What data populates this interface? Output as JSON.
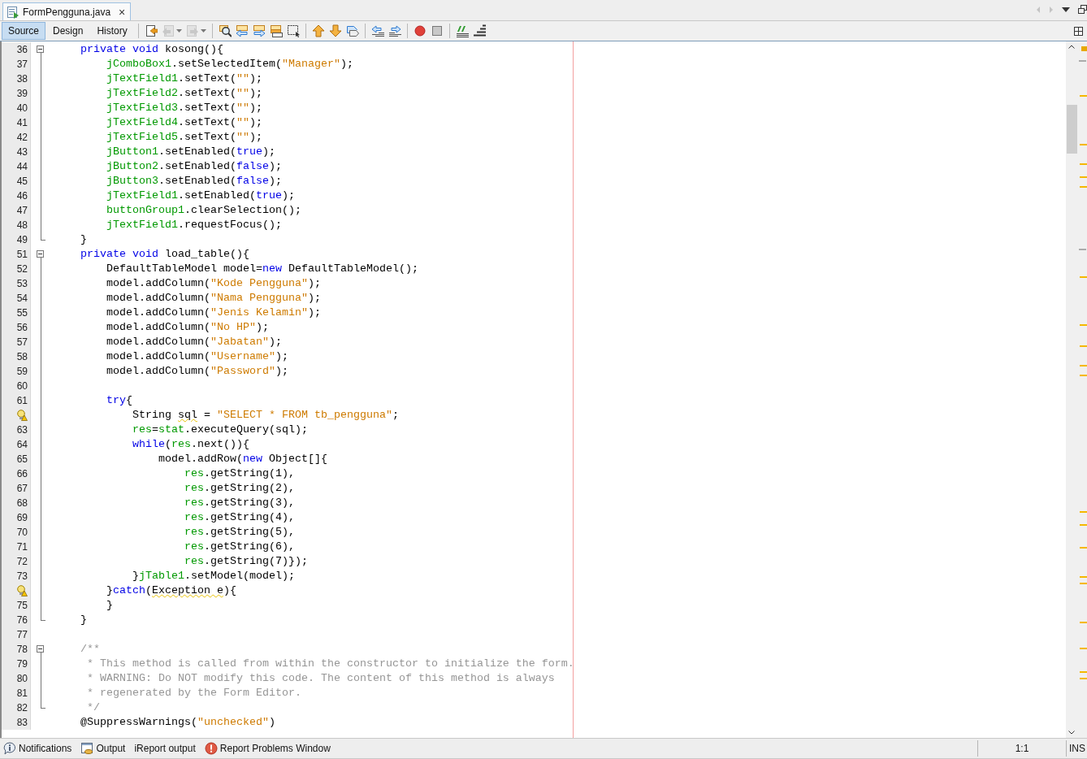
{
  "editor_tab": {
    "title": "FormPengguna.java",
    "close": "×"
  },
  "views": [
    {
      "label": "Source",
      "selected": true
    },
    {
      "label": "Design",
      "selected": false
    },
    {
      "label": "History",
      "selected": false
    }
  ],
  "toolbar": [
    {
      "kind": "last-edit",
      "disabled": false,
      "dropdown": false
    },
    {
      "kind": "back",
      "disabled": true,
      "dropdown": true
    },
    {
      "kind": "forward",
      "disabled": true,
      "dropdown": true
    },
    {
      "kind": "find",
      "disabled": false,
      "dropdown": false
    },
    {
      "kind": "find-previous",
      "disabled": false,
      "dropdown": false
    },
    {
      "kind": "find-next",
      "disabled": false,
      "dropdown": false
    },
    {
      "kind": "highlight",
      "disabled": false,
      "dropdown": false
    },
    {
      "kind": "select",
      "disabled": false,
      "dropdown": false
    },
    {
      "kind": "bookmark-previous",
      "disabled": false,
      "dropdown": false
    },
    {
      "kind": "bookmark-next",
      "disabled": false,
      "dropdown": false
    },
    {
      "kind": "bookmark-toggle",
      "disabled": false,
      "dropdown": false
    },
    {
      "kind": "shift-left",
      "disabled": false,
      "dropdown": false
    },
    {
      "kind": "shift-right",
      "disabled": false,
      "dropdown": false
    },
    {
      "kind": "record",
      "disabled": false,
      "dropdown": false
    },
    {
      "kind": "stop",
      "disabled": false,
      "dropdown": false
    },
    {
      "kind": "comment",
      "disabled": false,
      "dropdown": false
    },
    {
      "kind": "uncomment",
      "disabled": false,
      "dropdown": false
    }
  ],
  "lines": [
    {
      "number": "36",
      "warning": false,
      "kind": "start",
      "tokens": [
        {
          "kind": "keyword",
          "text": "    private"
        },
        {
          "kind": "keyword",
          "text": " void"
        },
        {
          "kind": "plain",
          "text": " kosong(){"
        }
      ]
    },
    {
      "number": "37",
      "warning": false,
      "kind": "inside",
      "tokens": [
        {
          "kind": "field",
          "text": "        jComboBox1"
        },
        {
          "kind": "plain",
          "text": ".setSelectedItem("
        },
        {
          "kind": "string",
          "text": "\"Manager\""
        },
        {
          "kind": "plain",
          "text": ");"
        }
      ]
    },
    {
      "number": "38",
      "warning": false,
      "kind": "inside",
      "tokens": [
        {
          "kind": "field",
          "text": "        jTextField1"
        },
        {
          "kind": "plain",
          "text": ".setText("
        },
        {
          "kind": "string",
          "text": "\"\""
        },
        {
          "kind": "plain",
          "text": ");"
        }
      ]
    },
    {
      "number": "39",
      "warning": false,
      "kind": "inside",
      "tokens": [
        {
          "kind": "field",
          "text": "        jTextField2"
        },
        {
          "kind": "plain",
          "text": ".setText("
        },
        {
          "kind": "string",
          "text": "\"\""
        },
        {
          "kind": "plain",
          "text": ");"
        }
      ]
    },
    {
      "number": "40",
      "warning": false,
      "kind": "inside",
      "tokens": [
        {
          "kind": "field",
          "text": "        jTextField3"
        },
        {
          "kind": "plain",
          "text": ".setText("
        },
        {
          "kind": "string",
          "text": "\"\""
        },
        {
          "kind": "plain",
          "text": ");"
        }
      ]
    },
    {
      "number": "41",
      "warning": false,
      "kind": "inside",
      "tokens": [
        {
          "kind": "field",
          "text": "        jTextField4"
        },
        {
          "kind": "plain",
          "text": ".setText("
        },
        {
          "kind": "string",
          "text": "\"\""
        },
        {
          "kind": "plain",
          "text": ");"
        }
      ]
    },
    {
      "number": "42",
      "warning": false,
      "kind": "inside",
      "tokens": [
        {
          "kind": "field",
          "text": "        jTextField5"
        },
        {
          "kind": "plain",
          "text": ".setText("
        },
        {
          "kind": "string",
          "text": "\"\""
        },
        {
          "kind": "plain",
          "text": ");"
        }
      ]
    },
    {
      "number": "43",
      "warning": false,
      "kind": "inside",
      "tokens": [
        {
          "kind": "field",
          "text": "        jButton1"
        },
        {
          "kind": "plain",
          "text": ".setEnabled("
        },
        {
          "kind": "keyword",
          "text": "true"
        },
        {
          "kind": "plain",
          "text": ");"
        }
      ]
    },
    {
      "number": "44",
      "warning": false,
      "kind": "inside",
      "tokens": [
        {
          "kind": "field",
          "text": "        jButton2"
        },
        {
          "kind": "plain",
          "text": ".setEnabled("
        },
        {
          "kind": "keyword",
          "text": "false"
        },
        {
          "kind": "plain",
          "text": ");"
        }
      ]
    },
    {
      "number": "45",
      "warning": false,
      "kind": "inside",
      "tokens": [
        {
          "kind": "field",
          "text": "        jButton3"
        },
        {
          "kind": "plain",
          "text": ".setEnabled("
        },
        {
          "kind": "keyword",
          "text": "false"
        },
        {
          "kind": "plain",
          "text": ");"
        }
      ]
    },
    {
      "number": "46",
      "warning": false,
      "kind": "inside",
      "tokens": [
        {
          "kind": "field",
          "text": "        jTextField1"
        },
        {
          "kind": "plain",
          "text": ".setEnabled("
        },
        {
          "kind": "keyword",
          "text": "true"
        },
        {
          "kind": "plain",
          "text": ");"
        }
      ]
    },
    {
      "number": "47",
      "warning": false,
      "kind": "inside",
      "tokens": [
        {
          "kind": "field",
          "text": "        buttonGroup1"
        },
        {
          "kind": "plain",
          "text": ".clearSelection();"
        }
      ]
    },
    {
      "number": "48",
      "warning": false,
      "kind": "inside",
      "tokens": [
        {
          "kind": "field",
          "text": "        jTextField1"
        },
        {
          "kind": "plain",
          "text": ".requestFocus();"
        }
      ]
    },
    {
      "number": "49",
      "warning": false,
      "kind": "end",
      "tokens": [
        {
          "kind": "plain",
          "text": "    }"
        }
      ]
    },
    {
      "number": "51",
      "warning": false,
      "kind": "start",
      "tokens": [
        {
          "kind": "keyword",
          "text": "    private"
        },
        {
          "kind": "keyword",
          "text": " void"
        },
        {
          "kind": "plain",
          "text": " load_table(){"
        }
      ]
    },
    {
      "number": "52",
      "warning": false,
      "kind": "inside",
      "tokens": [
        {
          "kind": "plain",
          "text": "        DefaultTableModel model="
        },
        {
          "kind": "keyword",
          "text": "new"
        },
        {
          "kind": "plain",
          "text": " DefaultTableModel();"
        }
      ]
    },
    {
      "number": "53",
      "warning": false,
      "kind": "inside",
      "tokens": [
        {
          "kind": "plain",
          "text": "        model.addColumn("
        },
        {
          "kind": "string",
          "text": "\"Kode Pengguna\""
        },
        {
          "kind": "plain",
          "text": ");"
        }
      ]
    },
    {
      "number": "54",
      "warning": false,
      "kind": "inside",
      "tokens": [
        {
          "kind": "plain",
          "text": "        model.addColumn("
        },
        {
          "kind": "string",
          "text": "\"Nama Pengguna\""
        },
        {
          "kind": "plain",
          "text": ");"
        }
      ]
    },
    {
      "number": "55",
      "warning": false,
      "kind": "inside",
      "tokens": [
        {
          "kind": "plain",
          "text": "        model.addColumn("
        },
        {
          "kind": "string",
          "text": "\"Jenis Kelamin\""
        },
        {
          "kind": "plain",
          "text": ");"
        }
      ]
    },
    {
      "number": "56",
      "warning": false,
      "kind": "inside",
      "tokens": [
        {
          "kind": "plain",
          "text": "        model.addColumn("
        },
        {
          "kind": "string",
          "text": "\"No HP\""
        },
        {
          "kind": "plain",
          "text": ");"
        }
      ]
    },
    {
      "number": "57",
      "warning": false,
      "kind": "inside",
      "tokens": [
        {
          "kind": "plain",
          "text": "        model.addColumn("
        },
        {
          "kind": "string",
          "text": "\"Jabatan\""
        },
        {
          "kind": "plain",
          "text": ");"
        }
      ]
    },
    {
      "number": "58",
      "warning": false,
      "kind": "inside",
      "tokens": [
        {
          "kind": "plain",
          "text": "        model.addColumn("
        },
        {
          "kind": "string",
          "text": "\"Username\""
        },
        {
          "kind": "plain",
          "text": ");"
        }
      ]
    },
    {
      "number": "59",
      "warning": false,
      "kind": "inside",
      "tokens": [
        {
          "kind": "plain",
          "text": "        model.addColumn("
        },
        {
          "kind": "string",
          "text": "\"Password\""
        },
        {
          "kind": "plain",
          "text": ");"
        }
      ]
    },
    {
      "number": "60",
      "warning": false,
      "kind": "inside"
    },
    {
      "number": "61",
      "warning": false,
      "kind": "inside",
      "tokens": [
        {
          "kind": "keyword",
          "text": "        try"
        },
        {
          "kind": "plain",
          "text": "{"
        }
      ]
    },
    {
      "warning": true,
      "kind": "inside",
      "tokens": [
        {
          "kind": "plain",
          "text": "            String "
        },
        {
          "kind": "warned",
          "text": "sql"
        },
        {
          "kind": "plain",
          "text": " = "
        },
        {
          "kind": "string",
          "text": "\"SELECT * FROM tb_pengguna\""
        },
        {
          "kind": "plain",
          "text": ";"
        }
      ]
    },
    {
      "number": "63",
      "warning": false,
      "kind": "inside",
      "tokens": [
        {
          "kind": "field",
          "text": "            res"
        },
        {
          "kind": "plain",
          "text": "="
        },
        {
          "kind": "field",
          "text": "stat"
        },
        {
          "kind": "plain",
          "text": ".executeQuery(sql);"
        }
      ]
    },
    {
      "number": "64",
      "warning": false,
      "kind": "inside",
      "tokens": [
        {
          "kind": "keyword",
          "text": "            while"
        },
        {
          "kind": "plain",
          "text": "("
        },
        {
          "kind": "field",
          "text": "res"
        },
        {
          "kind": "plain",
          "text": ".next()){"
        }
      ]
    },
    {
      "number": "65",
      "warning": false,
      "kind": "inside",
      "tokens": [
        {
          "kind": "plain",
          "text": "                model.addRow("
        },
        {
          "kind": "keyword",
          "text": "new"
        },
        {
          "kind": "plain",
          "text": " Object[]{"
        }
      ]
    },
    {
      "number": "66",
      "warning": false,
      "kind": "inside",
      "tokens": [
        {
          "kind": "field",
          "text": "                    res"
        },
        {
          "kind": "plain",
          "text": ".getString(1),"
        }
      ]
    },
    {
      "number": "67",
      "warning": false,
      "kind": "inside",
      "tokens": [
        {
          "kind": "field",
          "text": "                    res"
        },
        {
          "kind": "plain",
          "text": ".getString(2),"
        }
      ]
    },
    {
      "number": "68",
      "warning": false,
      "kind": "inside",
      "tokens": [
        {
          "kind": "field",
          "text": "                    res"
        },
        {
          "kind": "plain",
          "text": ".getString(3),"
        }
      ]
    },
    {
      "number": "69",
      "warning": false,
      "kind": "inside",
      "tokens": [
        {
          "kind": "field",
          "text": "                    res"
        },
        {
          "kind": "plain",
          "text": ".getString(4),"
        }
      ]
    },
    {
      "number": "70",
      "warning": false,
      "kind": "inside",
      "tokens": [
        {
          "kind": "field",
          "text": "                    res"
        },
        {
          "kind": "plain",
          "text": ".getString(5),"
        }
      ]
    },
    {
      "number": "71",
      "warning": false,
      "kind": "inside",
      "tokens": [
        {
          "kind": "field",
          "text": "                    res"
        },
        {
          "kind": "plain",
          "text": ".getString(6),"
        }
      ]
    },
    {
      "number": "72",
      "warning": false,
      "kind": "inside",
      "tokens": [
        {
          "kind": "field",
          "text": "                    res"
        },
        {
          "kind": "plain",
          "text": ".getString(7)});"
        }
      ]
    },
    {
      "number": "73",
      "warning": false,
      "kind": "inside",
      "tokens": [
        {
          "kind": "plain",
          "text": "            }"
        },
        {
          "kind": "field",
          "text": "jTable1"
        },
        {
          "kind": "plain",
          "text": ".setModel(model);"
        }
      ]
    },
    {
      "warning": true,
      "kind": "inside",
      "tokens": [
        {
          "kind": "plain",
          "text": "        }"
        },
        {
          "kind": "keyword",
          "text": "catch"
        },
        {
          "kind": "plain",
          "text": "("
        },
        {
          "kind": "warned",
          "text": "Exception e"
        },
        {
          "kind": "plain",
          "text": "){"
        }
      ]
    },
    {
      "number": "75",
      "warning": false,
      "kind": "inside",
      "tokens": [
        {
          "kind": "plain",
          "text": "        }"
        }
      ]
    },
    {
      "number": "76",
      "warning": false,
      "kind": "end",
      "tokens": [
        {
          "kind": "plain",
          "text": "    }"
        }
      ]
    },
    {
      "number": "77",
      "warning": false,
      "kind": "plain"
    },
    {
      "number": "78",
      "warning": false,
      "kind": "start",
      "tokens": [
        {
          "kind": "comment",
          "text": "    /**"
        }
      ]
    },
    {
      "number": "79",
      "warning": false,
      "kind": "inside",
      "tokens": [
        {
          "kind": "comment",
          "text": "     * This method is called from within the constructor to initialize the form."
        }
      ]
    },
    {
      "number": "80",
      "warning": false,
      "kind": "inside",
      "tokens": [
        {
          "kind": "comment",
          "text": "     * WARNING: Do NOT modify this code. The content of this method is always"
        }
      ]
    },
    {
      "number": "81",
      "warning": false,
      "kind": "inside",
      "tokens": [
        {
          "kind": "comment",
          "text": "     * regenerated by the Form Editor."
        }
      ]
    },
    {
      "number": "82",
      "warning": false,
      "kind": "end",
      "tokens": [
        {
          "kind": "comment",
          "text": "     */"
        }
      ]
    },
    {
      "number": "83",
      "warning": false,
      "kind": "plain",
      "tokens": [
        {
          "kind": "plain",
          "text": "    @SuppressWarnings("
        },
        {
          "kind": "string",
          "text": "\"unchecked\""
        },
        {
          "kind": "plain",
          "text": ")"
        }
      ]
    }
  ],
  "status_bar": {
    "items": [
      {
        "kind": "notifications",
        "label": "Notifications"
      },
      {
        "kind": "output",
        "label": "Output"
      },
      {
        "kind": "plain",
        "label": "iReport output"
      },
      {
        "kind": "problems",
        "label": "Report Problems Window"
      }
    ],
    "position": "1:1",
    "mode": "INS"
  }
}
